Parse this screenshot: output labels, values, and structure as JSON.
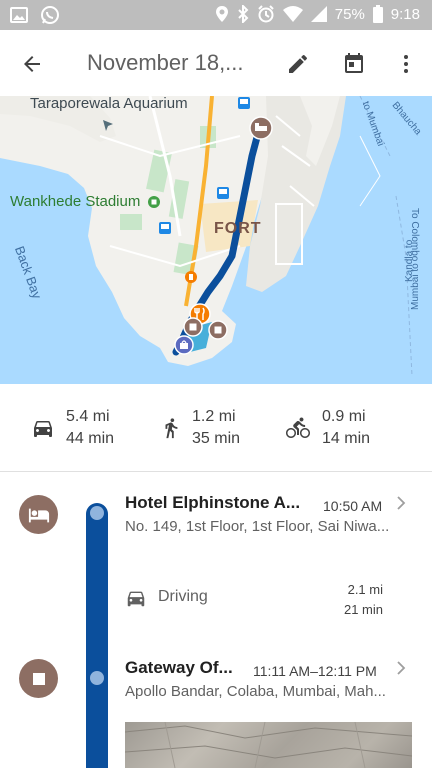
{
  "status_bar": {
    "battery": "75%",
    "time": "9:18",
    "icons": [
      "image-icon",
      "whatsapp-icon",
      "location-icon",
      "bluetooth-icon",
      "alarm-icon",
      "wifi-icon",
      "signal-icon",
      "battery-icon"
    ]
  },
  "app_bar": {
    "title": "November 18,...",
    "back_icon": "arrow-back-icon",
    "edit_icon": "pencil-icon",
    "calendar_icon": "calendar-icon",
    "more_icon": "more-vert-icon"
  },
  "map": {
    "labels": {
      "aquarium": "Taraporewala Aquarium",
      "stadium": "Wankhede Stadium",
      "fort": "FORT",
      "back_bay": "Back Bay",
      "to_mumbai": "to Mumbai",
      "bhaucha": "Bhaucha",
      "to_colombo": "To Colombo",
      "kandla": "Kandla to",
      "mumbai_to": "Mumbai to"
    },
    "colors": {
      "water": "#aadaff",
      "land": "#f2f1ed",
      "route": "#0b4f9c",
      "poi": "#8d6e63",
      "restaurant": "#f57c00",
      "shopping": "#5c6bc0"
    }
  },
  "summary": {
    "driving": {
      "distance": "5.4 mi",
      "duration": "44 min",
      "icon": "car-icon"
    },
    "walking": {
      "distance": "1.2 mi",
      "duration": "35 min",
      "icon": "walk-icon"
    },
    "cycling": {
      "distance": "0.9 mi",
      "duration": "14 min",
      "icon": "bike-icon"
    }
  },
  "itinerary": [
    {
      "name": "Hotel Elphinstone A...",
      "time": "10:50 AM",
      "address": "No. 149, 1st Floor, 1st Floor, Sai Niwa...",
      "icon": "hotel-bed-icon"
    },
    {
      "name": "Gateway Of...",
      "time": "11:11 AM–12:11 PM",
      "address": "Apollo Bandar, Colaba, Mumbai, Mah...",
      "icon": "landmark-square-icon"
    }
  ],
  "travel_segment": {
    "mode": "Driving",
    "distance": "2.1 mi",
    "duration": "21 min",
    "icon": "car-icon"
  },
  "accent": {
    "timeline": "#0b4f9c",
    "stop_marker": "#8d6e63"
  }
}
